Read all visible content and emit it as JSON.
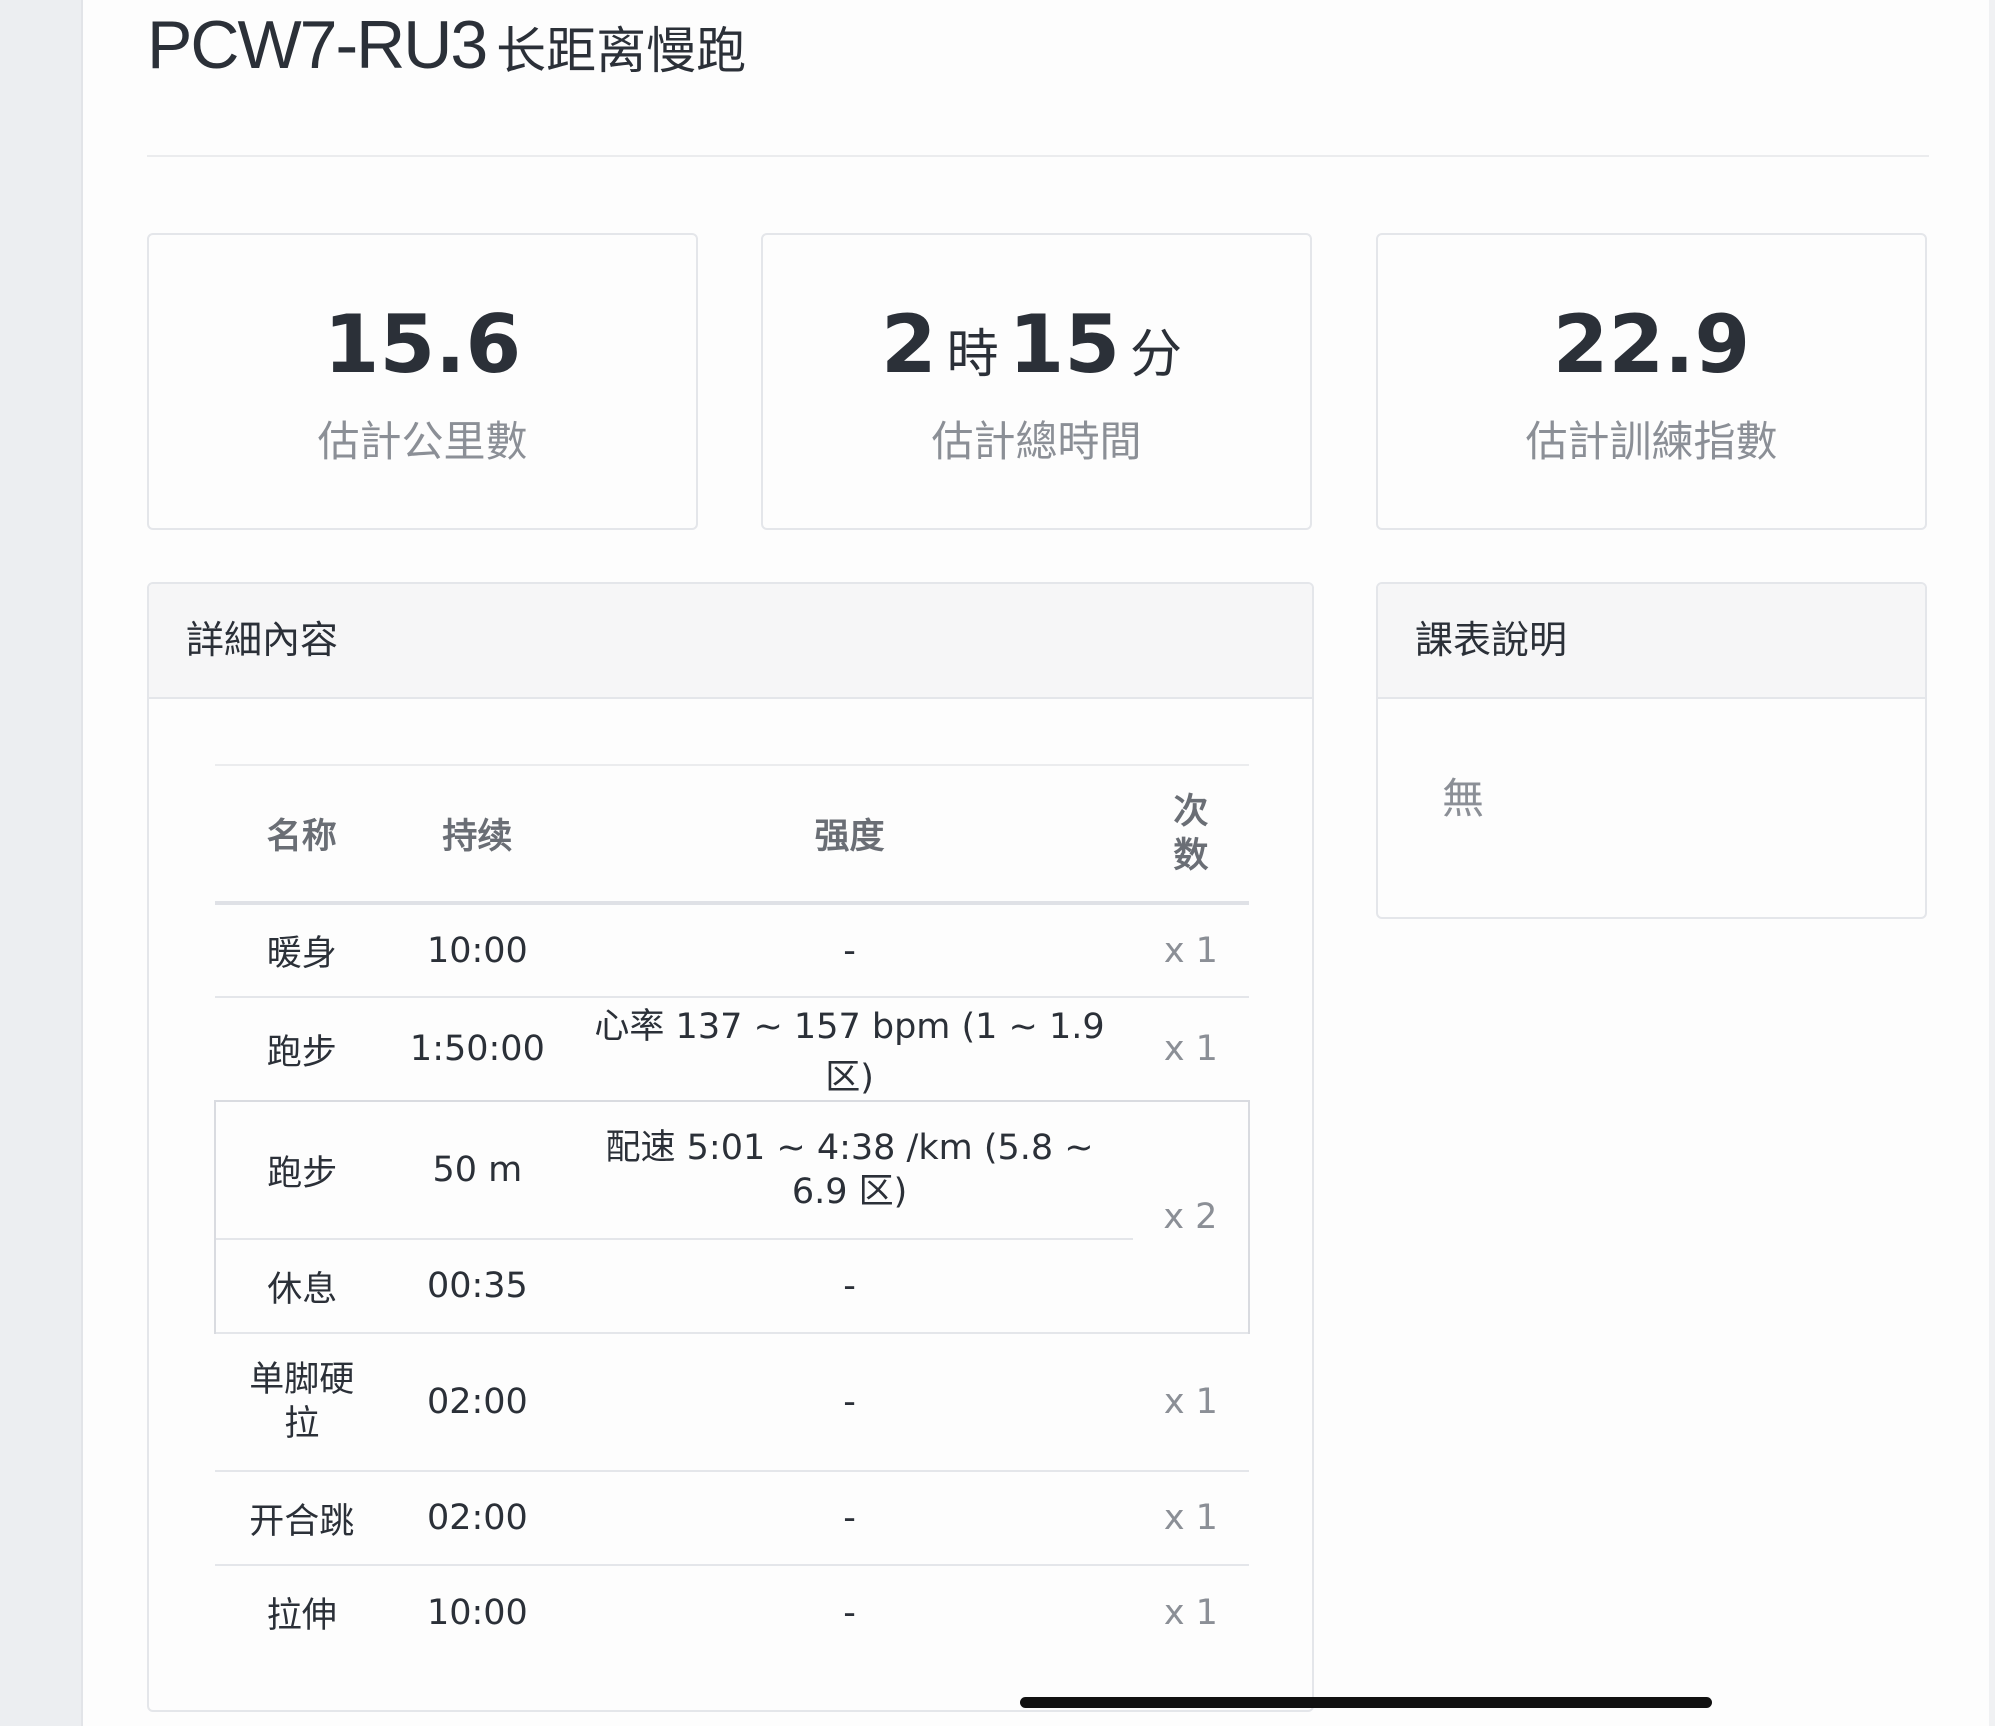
{
  "workout": {
    "code": "PCW7-RU3",
    "name": "长距离慢跑"
  },
  "stats": {
    "distance": {
      "value": "15.6",
      "label": "估計公里數"
    },
    "time": {
      "hours": "2",
      "hours_unit": "時",
      "minutes": "15",
      "minutes_unit": "分",
      "label": "估計總時間"
    },
    "training_index": {
      "value": "22.9",
      "label": "估計訓練指數"
    }
  },
  "details": {
    "title": "詳細內容",
    "headers": {
      "name": "名称",
      "duration": "持续",
      "intensity": "强度",
      "reps": "次数"
    },
    "rows": [
      {
        "name": "暖身",
        "duration": "10:00",
        "intensity": "-",
        "reps": "x 1"
      },
      {
        "name": "跑步",
        "duration": "1:50:00",
        "intensity": "心率 137 ~ 157 bpm (1 ~ 1.9 区)",
        "reps": "x 1"
      },
      {
        "name": "跑步",
        "duration": "50 m",
        "intensity": "配速 5:01 ~ 4:38 /km (5.8 ~ 6.9 区)",
        "reps": "x 2"
      },
      {
        "name": "休息",
        "duration": "00:35",
        "intensity": "-"
      },
      {
        "name": "单脚硬拉",
        "duration": "02:00",
        "intensity": "-",
        "reps": "x 1"
      },
      {
        "name": "开合跳",
        "duration": "02:00",
        "intensity": "-",
        "reps": "x 1"
      },
      {
        "name": "拉伸",
        "duration": "10:00",
        "intensity": "-",
        "reps": "x 1"
      }
    ]
  },
  "notes": {
    "title": "課表說明",
    "text": "無"
  }
}
